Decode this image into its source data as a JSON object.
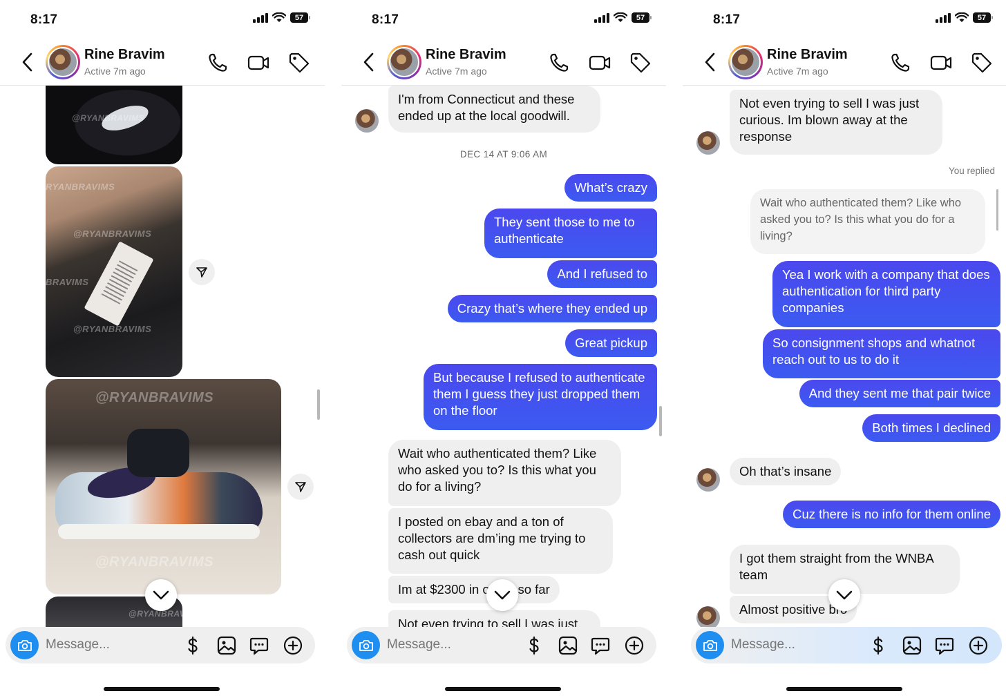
{
  "status": {
    "time": "8:17",
    "battery": "57"
  },
  "header": {
    "name": "Rine Bravim",
    "active": "Active 7m ago"
  },
  "composer": {
    "placeholder": "Message..."
  },
  "panel1": {
    "watermarks": [
      "@RYANBRAVIMS",
      "RYANBRAVIMS",
      "BRAVIMS",
      "@RYANBRAVIMS"
    ]
  },
  "panel2": {
    "messages": [
      {
        "side": "in",
        "text": "I'm from Connecticut and these ended up at the local goodwill."
      },
      {
        "side": "out",
        "text": "What’s crazy"
      },
      {
        "side": "out",
        "text": "They sent those to me to authenticate"
      },
      {
        "side": "out",
        "text": "And I refused to"
      },
      {
        "side": "out",
        "text": "Crazy that’s where they ended up"
      },
      {
        "side": "out",
        "text": "Great pickup"
      },
      {
        "side": "out",
        "text": "But because I refused to authenticate them I guess they just dropped them on the floor"
      },
      {
        "side": "in",
        "text": "Wait who authenticated them? Like who asked you to? Is this what you do for a living?"
      },
      {
        "side": "in",
        "text": "I posted on ebay and a ton of collectors are dm’ing me trying to cash out quick"
      },
      {
        "side": "in",
        "text": "Im at $2300 in offers so far"
      },
      {
        "side": "in",
        "text": "Not even trying to sell I was just"
      }
    ],
    "timestamp": "DEC 14 AT 9:06 AM"
  },
  "panel3": {
    "messages": [
      {
        "side": "in",
        "text": "Not even trying to sell I was just curious. Im blown away at the response"
      },
      {
        "side": "reply",
        "text": "Wait who authenticated them? Like who asked you to? Is this what you do for a living?"
      },
      {
        "side": "out",
        "text": "Yea I work with a company that does authentication for third party companies"
      },
      {
        "side": "out",
        "text": "So consignment shops and whatnot reach out to us to do it"
      },
      {
        "side": "out",
        "text": "And they sent me that pair twice"
      },
      {
        "side": "out",
        "text": "Both times I declined"
      },
      {
        "side": "in",
        "text": "Oh that’s insane"
      },
      {
        "side": "out",
        "text": "Cuz there is no info for them online"
      },
      {
        "side": "in",
        "text": "I got them straight from the WNBA team"
      },
      {
        "side": "in",
        "text": "Almost positive bro"
      }
    ],
    "you_replied": "You replied"
  },
  "icons": [
    "back-icon",
    "phone-icon",
    "video-icon",
    "tag-icon",
    "camera-icon",
    "dollar-icon",
    "image-icon",
    "sticker-icon",
    "plus-icon",
    "share-icon",
    "chevron-down-icon"
  ],
  "colors": {
    "outgoing": "#4b48ee",
    "outgoing_alt": "#3b5bf0",
    "incoming": "#efefef",
    "accent": "#1f8ef1"
  }
}
